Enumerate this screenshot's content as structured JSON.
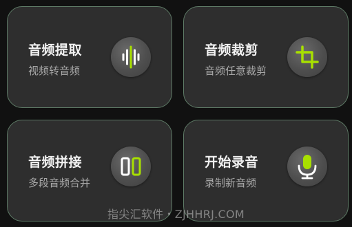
{
  "colors": {
    "background": "#111111",
    "card_background": "#2e2e2e",
    "card_border": "#5e7a66",
    "accent_green": "#a8e000",
    "icon_white": "#ffffff"
  },
  "cards": [
    {
      "title": "音频提取",
      "subtitle": "视频转音频",
      "icon": "waveform-icon"
    },
    {
      "title": "音频裁剪",
      "subtitle": "音频任意裁剪",
      "icon": "crop-icon"
    },
    {
      "title": "音频拼接",
      "subtitle": "多段音频合并",
      "icon": "merge-icon"
    },
    {
      "title": "开始录音",
      "subtitle": "录制新音频",
      "icon": "microphone-icon"
    }
  ],
  "watermark": {
    "text": "指尖汇软件・ZJHHRJ.COM"
  }
}
